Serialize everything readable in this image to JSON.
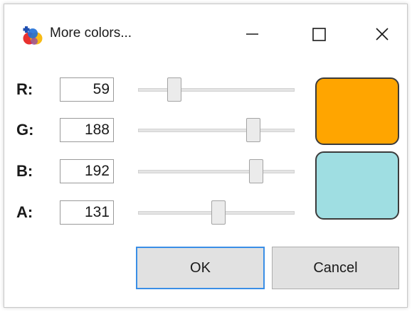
{
  "window": {
    "title": "More colors...",
    "minimize_glyph": "minimize-icon",
    "maximize_glyph": "maximize-icon",
    "close_glyph": "close-icon"
  },
  "channels": [
    {
      "label": "R:",
      "value": "59",
      "level": 0.231
    },
    {
      "label": "G:",
      "value": "188",
      "level": 0.737
    },
    {
      "label": "B:",
      "value": "192",
      "level": 0.753
    },
    {
      "label": "A:",
      "value": "131",
      "level": 0.514
    }
  ],
  "colors": {
    "original": "#FFA500",
    "new": "#9FDEE2"
  },
  "buttons": {
    "ok": "OK",
    "cancel": "Cancel"
  }
}
